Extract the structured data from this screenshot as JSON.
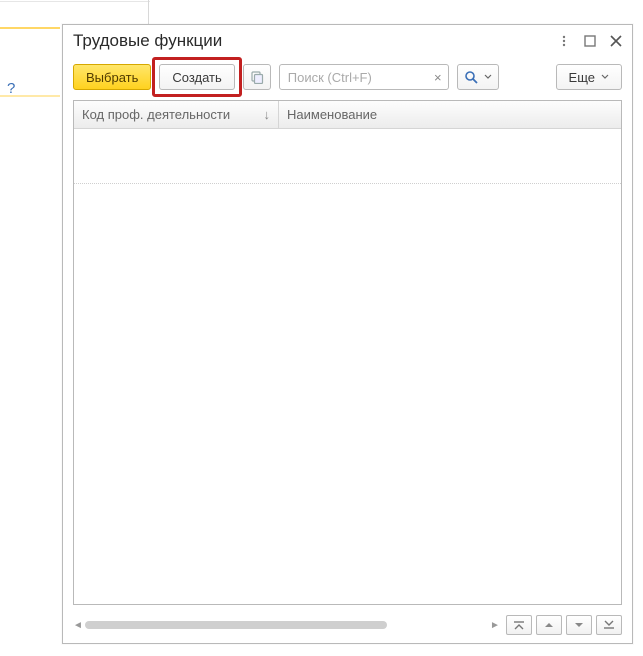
{
  "help_hint": "?",
  "window": {
    "title": "Трудовые функции"
  },
  "toolbar": {
    "select_label": "Выбрать",
    "create_label": "Создать",
    "more_label": "Еще"
  },
  "search": {
    "placeholder": "Поиск (Ctrl+F)",
    "value": ""
  },
  "table": {
    "columns": {
      "code": "Код проф. деятельности",
      "name": "Наименование"
    },
    "rows": []
  },
  "icons": {
    "menu": "menu",
    "maximize": "maximize",
    "close": "close",
    "copy": "copy",
    "clear": "×",
    "search": "search",
    "sort_asc": "↓",
    "scroll_left": "◄",
    "scroll_right": "►",
    "nav_first": "⤒",
    "nav_up": "▲",
    "nav_down": "▼",
    "nav_last": "⤓"
  }
}
